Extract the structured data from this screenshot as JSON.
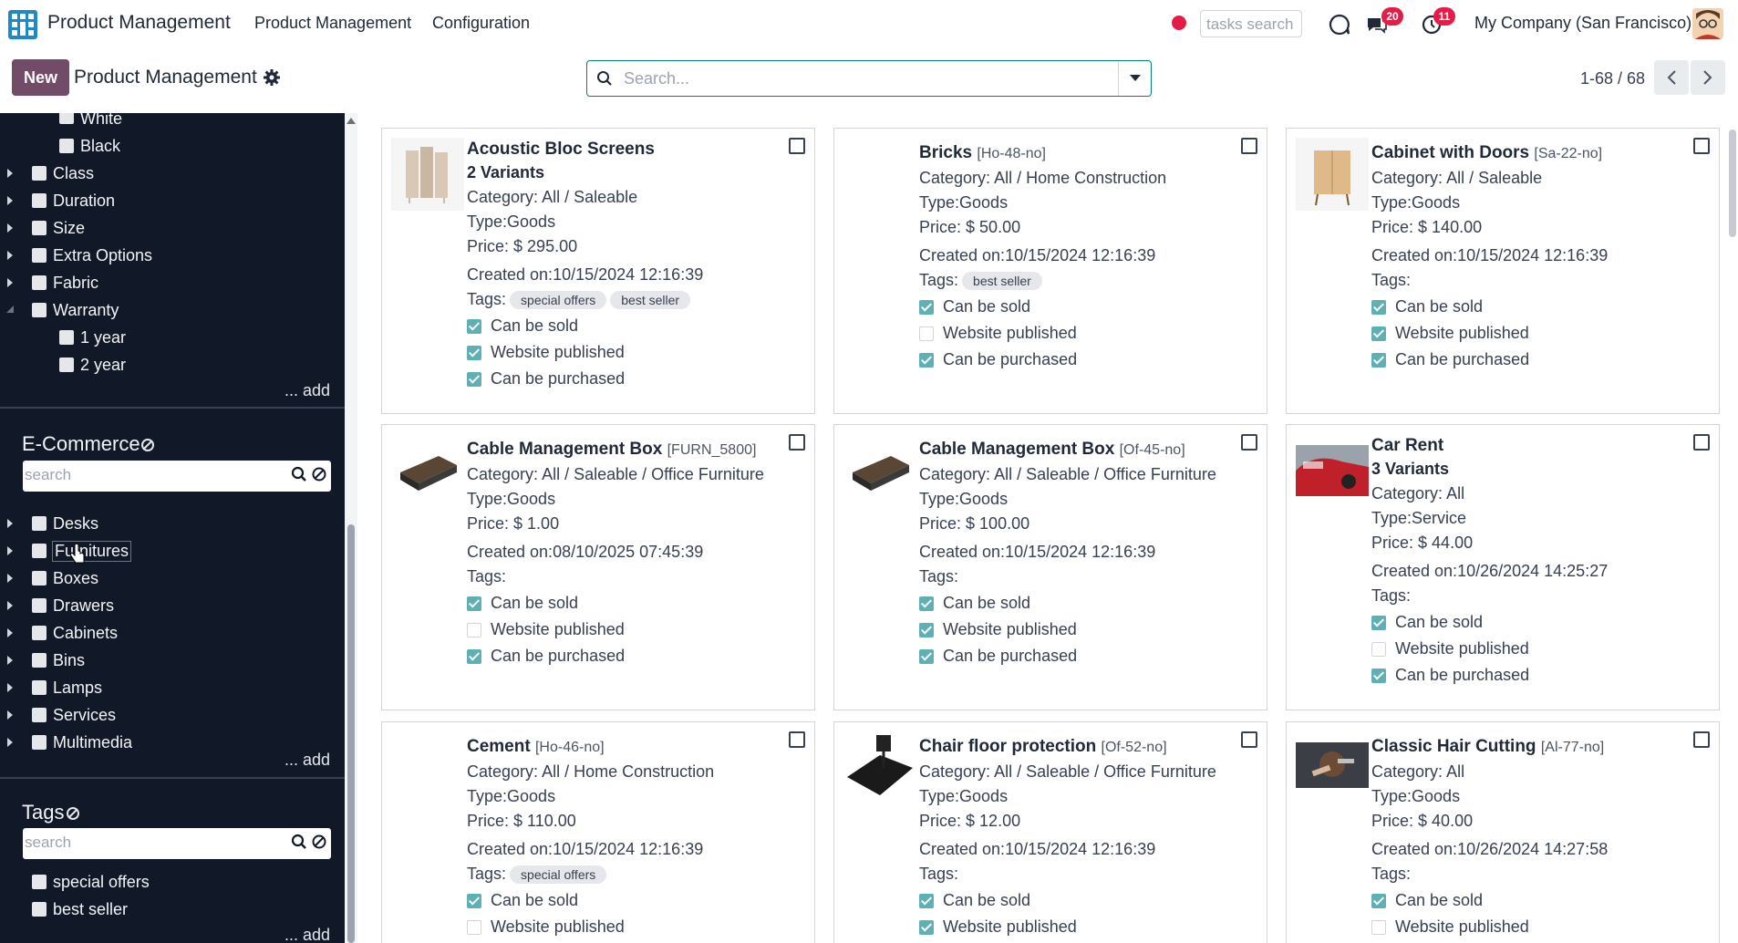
{
  "topbar": {
    "app_name": "Product Management",
    "menu": [
      "Product Management",
      "Configuration"
    ],
    "tasks_search_placeholder": "tasks search",
    "chat_badge": "20",
    "activity_badge": "11",
    "company": "My Company (San Francisco)"
  },
  "control": {
    "new_label": "New",
    "title": "Product Management",
    "search_placeholder": "Search...",
    "pager": "1-68 / 68"
  },
  "sidebar": {
    "attributes_sub_top": [
      "White",
      "Black"
    ],
    "attributes": [
      "Class",
      "Duration",
      "Size",
      "Extra Options",
      "Fabric",
      "Warranty"
    ],
    "warranty_children": [
      "1 year",
      "2 year"
    ],
    "add_label": "... add",
    "ecommerce": {
      "title": "E-Commerce",
      "search_placeholder": "search",
      "items": [
        "Desks",
        "Furnitures",
        "Boxes",
        "Drawers",
        "Cabinets",
        "Bins",
        "Lamps",
        "Services",
        "Multimedia"
      ]
    },
    "tags": {
      "title": "Tags",
      "search_placeholder": "search",
      "items": [
        "special offers",
        "best seller"
      ]
    }
  },
  "labels": {
    "category": "Category:",
    "type": "Type:",
    "price": "Price:",
    "created": "Created on:",
    "tags": "Tags:",
    "can_be_sold": "Can be sold",
    "website_published": "Website published",
    "can_be_purchased": "Can be purchased"
  },
  "products": [
    {
      "name": "Acoustic Bloc Screens",
      "ref": "",
      "variants": "2 Variants",
      "category": "All / Saleable",
      "type": "Goods",
      "price": "$ 295.00",
      "created": "10/15/2024 12:16:39",
      "tags": [
        "special offers",
        "best seller"
      ],
      "sold": true,
      "published": true,
      "purchased": true,
      "thumb": "screen-image"
    },
    {
      "name": "Bricks",
      "ref": "[Ho-48-no]",
      "variants": "",
      "category": "All / Home Construction",
      "type": "Goods",
      "price": "$ 50.00",
      "created": "10/15/2024 12:16:39",
      "tags": [
        "best seller"
      ],
      "sold": true,
      "published": false,
      "purchased": true,
      "thumb": ""
    },
    {
      "name": "Cabinet with Doors",
      "ref": "[Sa-22-no]",
      "variants": "",
      "category": "All / Saleable",
      "type": "Goods",
      "price": "$ 140.00",
      "created": "10/15/2024 12:16:39",
      "tags": [],
      "sold": true,
      "published": true,
      "purchased": true,
      "thumb": "cabinet-image"
    },
    {
      "name": "Cable Management Box",
      "ref": "[FURN_5800]",
      "variants": "",
      "category": "All / Saleable / Office Furniture",
      "type": "Goods",
      "price": "$ 1.00",
      "created": "08/10/2025 07:45:39",
      "tags": [],
      "sold": true,
      "published": false,
      "purchased": true,
      "thumb": "box-image"
    },
    {
      "name": "Cable Management Box",
      "ref": "[Of-45-no]",
      "variants": "",
      "category": "All / Saleable / Office Furniture",
      "type": "Goods",
      "price": "$ 100.00",
      "created": "10/15/2024 12:16:39",
      "tags": [],
      "sold": true,
      "published": true,
      "purchased": true,
      "thumb": "box-image"
    },
    {
      "name": "Car Rent",
      "ref": "",
      "variants": "3 Variants",
      "category": "All",
      "type": "Service",
      "price": "$ 44.00",
      "created": "10/26/2024 14:25:27",
      "tags": [],
      "sold": true,
      "published": false,
      "purchased": true,
      "thumb": "car-image"
    },
    {
      "name": "Cement",
      "ref": "[Ho-46-no]",
      "variants": "",
      "category": "All / Home Construction",
      "type": "Goods",
      "price": "$ 110.00",
      "created": "10/15/2024 12:16:39",
      "tags": [
        "special offers"
      ],
      "sold": true,
      "published": false,
      "purchased": null,
      "thumb": ""
    },
    {
      "name": "Chair floor protection",
      "ref": "[Of-52-no]",
      "variants": "",
      "category": "All / Saleable / Office Furniture",
      "type": "Goods",
      "price": "$ 12.00",
      "created": "10/15/2024 12:16:39",
      "tags": [],
      "sold": true,
      "published": true,
      "purchased": null,
      "thumb": "mat-image"
    },
    {
      "name": "Classic Hair Cutting",
      "ref": "[Al-77-no]",
      "variants": "",
      "category": "All",
      "type": "Goods",
      "price": "$ 40.00",
      "created": "10/26/2024 14:27:58",
      "tags": [],
      "sold": true,
      "published": false,
      "purchased": null,
      "thumb": "haircut-image"
    }
  ]
}
